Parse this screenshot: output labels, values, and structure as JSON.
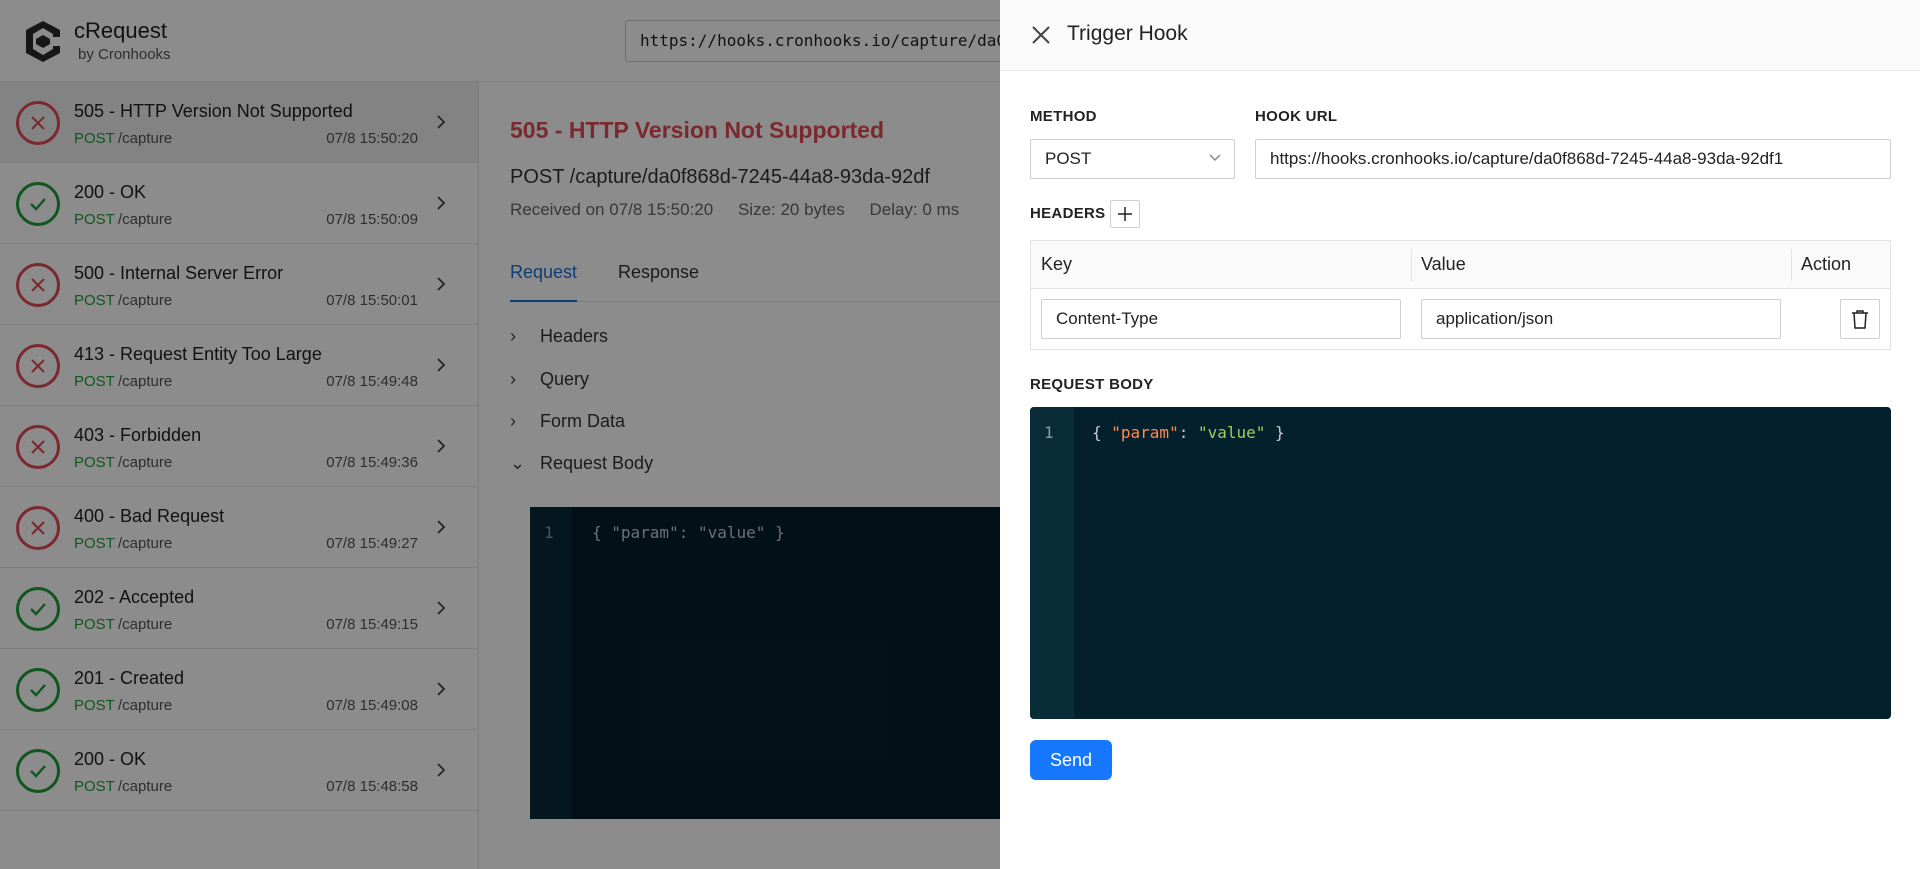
{
  "app": {
    "title": "cRequest",
    "subtitle": "by Cronhooks",
    "capture_url": "https://hooks.cronhooks.io/capture/da0f868d-7245-44a8-93da-92df1"
  },
  "requests": [
    {
      "title": "505 - HTTP Version Not Supported",
      "method": "POST",
      "path": "/capture",
      "time": "07/8 15:50:20",
      "status": "error"
    },
    {
      "title": "200 - OK",
      "method": "POST",
      "path": "/capture",
      "time": "07/8 15:50:09",
      "status": "ok"
    },
    {
      "title": "500 - Internal Server Error",
      "method": "POST",
      "path": "/capture",
      "time": "07/8 15:50:01",
      "status": "error"
    },
    {
      "title": "413 - Request Entity Too Large",
      "method": "POST",
      "path": "/capture",
      "time": "07/8 15:49:48",
      "status": "error"
    },
    {
      "title": "403 - Forbidden",
      "method": "POST",
      "path": "/capture",
      "time": "07/8 15:49:36",
      "status": "error"
    },
    {
      "title": "400 - Bad Request",
      "method": "POST",
      "path": "/capture",
      "time": "07/8 15:49:27",
      "status": "error"
    },
    {
      "title": "202 - Accepted",
      "method": "POST",
      "path": "/capture",
      "time": "07/8 15:49:15",
      "status": "ok"
    },
    {
      "title": "201 - Created",
      "method": "POST",
      "path": "/capture",
      "time": "07/8 15:49:08",
      "status": "ok"
    },
    {
      "title": "200 - OK",
      "method": "POST",
      "path": "/capture",
      "time": "07/8 15:48:58",
      "status": "ok"
    }
  ],
  "detail": {
    "title": "505 - HTTP Version Not Supported",
    "url": "POST  /capture/da0f868d-7245-44a8-93da-92df",
    "received": "Received on 07/8 15:50:20",
    "size": "Size: 20 bytes",
    "delay": "Delay: 0 ms",
    "tabs": [
      "Request",
      "Response"
    ],
    "sections": [
      "Headers",
      "Query",
      "Form Data",
      "Request Body"
    ],
    "body_line_number": "1",
    "body_code": "{ \"param\": \"value\" }"
  },
  "drawer": {
    "title": "Trigger Hook",
    "method_label": "METHOD",
    "method_value": "POST",
    "url_label": "HOOK URL",
    "url_value": "https://hooks.cronhooks.io/capture/da0f868d-7245-44a8-93da-92df1",
    "headers_label": "HEADERS",
    "columns": {
      "key": "Key",
      "value": "Value",
      "action": "Action"
    },
    "header_row": {
      "key": "Content-Type",
      "value": "application/json"
    },
    "body_label": "REQUEST BODY",
    "body_line_number": "1",
    "body_open": "{ ",
    "body_key": "\"param\"",
    "body_colon": ": ",
    "body_val": "\"value\"",
    "body_close": " }",
    "send_label": "Send"
  },
  "colors": {
    "error": "#e04b57",
    "ok": "#1f9d3a",
    "primary": "#1677ff",
    "code_bg": "#04202c"
  }
}
